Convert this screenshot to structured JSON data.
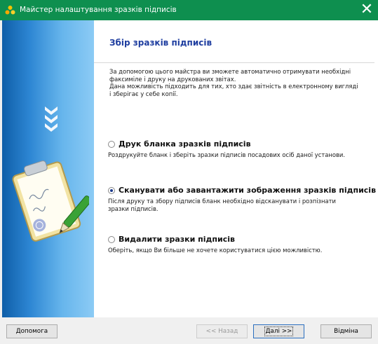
{
  "window": {
    "title": "Майстер налаштування зразків підписів",
    "close_glyph": "✕",
    "accent_color": "#0e8f4f"
  },
  "sidebar": {
    "icons": [
      "chevrons-down-icon",
      "clipboard-signature-icon"
    ]
  },
  "header": {
    "title": "Збір зразків підписів"
  },
  "intro": {
    "lines": [
      "За допомогою цього майстра ви зможете автоматично отримувати необхідні",
      "факсиміле і друку на друкованих звітах.",
      "Дана можливість підходить для тих, хто здає звітність в електронному вигляді",
      "і зберігає у себе копії."
    ]
  },
  "options": [
    {
      "label": "Друк бланка зразків підписів",
      "checked": false,
      "desc": [
        "Роздрукуйте бланк і зберіть зразки підписів посадових осіб даної установи."
      ]
    },
    {
      "label": "Сканувати або завантажити зображення зразків підписів",
      "checked": true,
      "desc": [
        "Після друку та збору підписів бланк необхідно відсканувати і розпізнати",
        "зразки підписів."
      ]
    },
    {
      "label": "Видалити зразки підписів",
      "checked": false,
      "desc": [
        "Оберіть, якщо Ви більше не хочете користуватися цією можливістю."
      ]
    }
  ],
  "buttons": {
    "help": "Допомога",
    "back": "<< Назад",
    "next": "Далі >>",
    "cancel": "Відміна"
  }
}
